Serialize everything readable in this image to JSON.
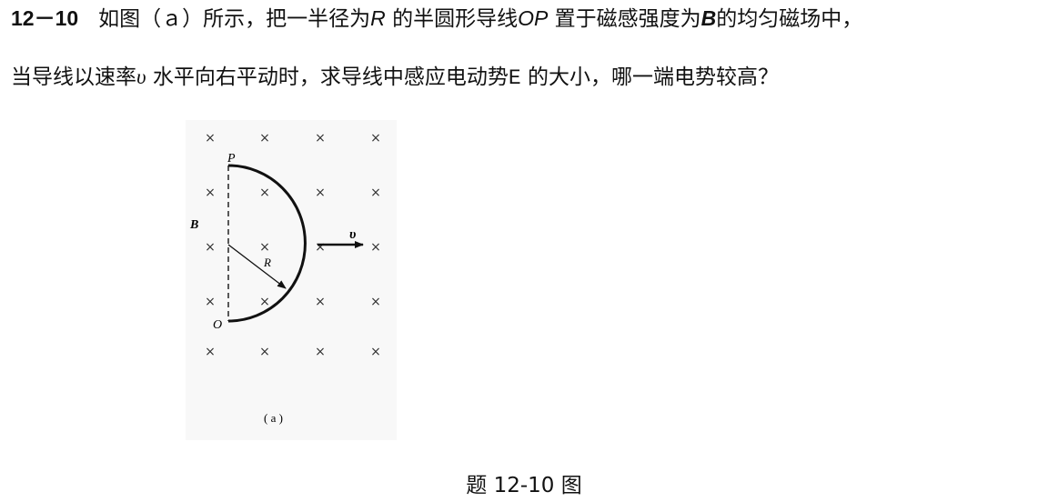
{
  "problem": {
    "number": "12－10",
    "line1": {
      "a": "如图（ａ）所示，把一半径为",
      "r": "R",
      "b": " 的半圆形导线",
      "op": "OP",
      "c": " 置于磁感强度为",
      "bsym": "B",
      "d": "的均匀磁场中，"
    },
    "line2": {
      "a": "当导线以速率",
      "v": "υ",
      "b": " 水平向右平动时，求导线中感应电动势",
      "e": "E",
      "c": " 的大小，哪一端电势较高？"
    }
  },
  "figure": {
    "field_mark": "×",
    "label_P": "P",
    "label_O": "O",
    "label_B": "B",
    "label_R": "R",
    "label_v": "υ",
    "sub_label": "( a )"
  },
  "caption": "题 12-10 图"
}
